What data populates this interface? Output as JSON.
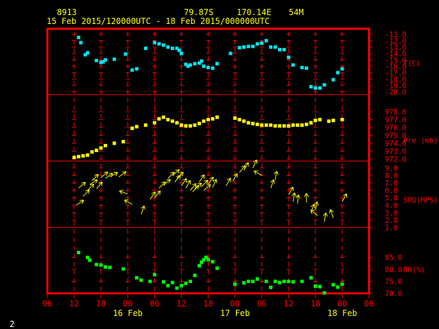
{
  "colors": {
    "background": "#000000",
    "frame": "#ff0000",
    "header_text": "#ffff00",
    "axis_labels": "#ff0000",
    "date_labels": "#ffff00",
    "temperature": "#00e5ee",
    "pressure": "#ffff00",
    "wind": "#ffff00",
    "humidity": "#00ff00",
    "page_number": "#ffffff"
  },
  "header": {
    "station_id": "8913",
    "latitude": "79.87S",
    "longitude": "170.14E",
    "elevation": "54M",
    "period": "15 Feb 2015/120000UTC - 18 Feb 2015/000000UTC"
  },
  "page_number": "2",
  "chart_data": {
    "type": "multi-panel time series",
    "x_axis": {
      "start": "2015-02-15 06:00 UTC",
      "end": "2015-02-18 06:00 UTC",
      "tick_labels": [
        "06",
        "12",
        "18",
        "00",
        "06",
        "12",
        "18",
        "00",
        "06",
        "12",
        "18",
        "00",
        "06"
      ],
      "date_labels": [
        {
          "label": "16 Feb",
          "at": "2015-02-16 00:00 UTC"
        },
        {
          "label": "17 Feb",
          "at": "2015-02-17 00:00 UTC"
        },
        {
          "label": "18 Feb",
          "at": "2015-02-18 00:00 UTC"
        }
      ]
    },
    "panels": [
      {
        "id": "temperature",
        "label": "T(C)",
        "type": "scatter",
        "ylim": [
          -20.0,
          -11.0
        ],
        "yticks": [
          "-11.0",
          "-12.0",
          "-13.0",
          "-14.0",
          "-15.0",
          "-16.0",
          "-17.0",
          "-18.0",
          "-19.0",
          "-20.0"
        ],
        "points": [
          [
            "2015-02-15 13:00",
            -11.5
          ],
          [
            "2015-02-15 13:30",
            -12.3
          ],
          [
            "2015-02-15 14:30",
            -14.2
          ],
          [
            "2015-02-15 15:00",
            -13.9
          ],
          [
            "2015-02-15 17:00",
            -15.1
          ],
          [
            "2015-02-15 18:00",
            -15.4
          ],
          [
            "2015-02-15 18:30",
            -15.3
          ],
          [
            "2015-02-15 19:00",
            -15.0
          ],
          [
            "2015-02-15 21:00",
            -14.9
          ],
          [
            "2015-02-15 23:30",
            -14.1
          ],
          [
            "2015-02-16 01:00",
            -16.6
          ],
          [
            "2015-02-16 02:00",
            -16.4
          ],
          [
            "2015-02-16 04:00",
            -13.2
          ],
          [
            "2015-02-16 06:00",
            -12.3
          ],
          [
            "2015-02-16 07:00",
            -12.5
          ],
          [
            "2015-02-16 08:00",
            -12.7
          ],
          [
            "2015-02-16 09:00",
            -13.0
          ],
          [
            "2015-02-16 10:00",
            -13.2
          ],
          [
            "2015-02-16 11:00",
            -13.2
          ],
          [
            "2015-02-16 11:30",
            -13.5
          ],
          [
            "2015-02-16 12:00",
            -14.0
          ],
          [
            "2015-02-16 13:00",
            -15.7
          ],
          [
            "2015-02-16 13:30",
            -16.0
          ],
          [
            "2015-02-16 14:00",
            -15.8
          ],
          [
            "2015-02-16 15:00",
            -15.6
          ],
          [
            "2015-02-16 16:00",
            -15.5
          ],
          [
            "2015-02-16 16:30",
            -15.2
          ],
          [
            "2015-02-16 17:00",
            -16.0
          ],
          [
            "2015-02-16 18:00",
            -16.2
          ],
          [
            "2015-02-16 19:00",
            -16.3
          ],
          [
            "2015-02-16 20:00",
            -15.6
          ],
          [
            "2015-02-16 23:00",
            -14.0
          ],
          [
            "2015-02-17 01:00",
            -13.1
          ],
          [
            "2015-02-17 02:00",
            -13.0
          ],
          [
            "2015-02-17 03:00",
            -12.9
          ],
          [
            "2015-02-17 04:00",
            -12.9
          ],
          [
            "2015-02-17 05:00",
            -12.5
          ],
          [
            "2015-02-17 06:00",
            -12.4
          ],
          [
            "2015-02-17 07:00",
            -12.0
          ],
          [
            "2015-02-17 08:00",
            -13.0
          ],
          [
            "2015-02-17 09:00",
            -13.0
          ],
          [
            "2015-02-17 10:00",
            -13.4
          ],
          [
            "2015-02-17 11:00",
            -13.4
          ],
          [
            "2015-02-17 12:00",
            -14.6
          ],
          [
            "2015-02-17 13:00",
            -15.8
          ],
          [
            "2015-02-17 15:00",
            -16.2
          ],
          [
            "2015-02-17 16:00",
            -16.3
          ],
          [
            "2015-02-17 17:00",
            -19.2
          ],
          [
            "2015-02-17 18:00",
            -19.4
          ],
          [
            "2015-02-17 19:00",
            -19.4
          ],
          [
            "2015-02-17 20:00",
            -18.9
          ],
          [
            "2015-02-17 22:00",
            -18.1
          ],
          [
            "2015-02-17 23:00",
            -17.0
          ],
          [
            "2015-02-18 00:00",
            -16.4
          ]
        ]
      },
      {
        "id": "pressure",
        "label": "Pre (mb)",
        "type": "scatter",
        "ylim": [
          972.0,
          978.0
        ],
        "yticks": [
          "978.0",
          "977.0",
          "976.0",
          "975.0",
          "974.0",
          "973.0",
          "972.0"
        ],
        "points": [
          [
            "2015-02-15 12:00",
            972.2
          ],
          [
            "2015-02-15 13:00",
            972.3
          ],
          [
            "2015-02-15 14:00",
            972.4
          ],
          [
            "2015-02-15 15:00",
            972.5
          ],
          [
            "2015-02-15 16:00",
            972.9
          ],
          [
            "2015-02-15 17:00",
            973.1
          ],
          [
            "2015-02-15 18:00",
            973.4
          ],
          [
            "2015-02-15 19:00",
            973.7
          ],
          [
            "2015-02-15 21:00",
            974.0
          ],
          [
            "2015-02-15 23:00",
            974.2
          ],
          [
            "2015-02-16 01:00",
            975.9
          ],
          [
            "2015-02-16 02:00",
            976.1
          ],
          [
            "2015-02-16 04:00",
            976.3
          ],
          [
            "2015-02-16 06:00",
            976.6
          ],
          [
            "2015-02-16 07:00",
            977.1
          ],
          [
            "2015-02-16 08:00",
            977.3
          ],
          [
            "2015-02-16 09:00",
            977.0
          ],
          [
            "2015-02-16 10:00",
            976.8
          ],
          [
            "2015-02-16 11:00",
            976.6
          ],
          [
            "2015-02-16 12:00",
            976.3
          ],
          [
            "2015-02-16 13:00",
            976.2
          ],
          [
            "2015-02-16 14:00",
            976.2
          ],
          [
            "2015-02-16 15:00",
            976.3
          ],
          [
            "2015-02-16 16:00",
            976.5
          ],
          [
            "2015-02-16 17:00",
            976.8
          ],
          [
            "2015-02-16 18:00",
            977.0
          ],
          [
            "2015-02-16 19:00",
            977.1
          ],
          [
            "2015-02-16 20:00",
            977.3
          ],
          [
            "2015-02-17 00:00",
            977.2
          ],
          [
            "2015-02-17 01:00",
            977.0
          ],
          [
            "2015-02-17 02:00",
            976.8
          ],
          [
            "2015-02-17 03:00",
            976.6
          ],
          [
            "2015-02-17 04:00",
            976.5
          ],
          [
            "2015-02-17 05:00",
            976.4
          ],
          [
            "2015-02-17 06:00",
            976.3
          ],
          [
            "2015-02-17 07:00",
            976.3
          ],
          [
            "2015-02-17 08:00",
            976.3
          ],
          [
            "2015-02-17 09:00",
            976.2
          ],
          [
            "2015-02-17 10:00",
            976.2
          ],
          [
            "2015-02-17 11:00",
            976.2
          ],
          [
            "2015-02-17 12:00",
            976.2
          ],
          [
            "2015-02-17 13:00",
            976.3
          ],
          [
            "2015-02-17 14:00",
            976.3
          ],
          [
            "2015-02-17 15:00",
            976.3
          ],
          [
            "2015-02-17 16:00",
            976.4
          ],
          [
            "2015-02-17 17:00",
            976.6
          ],
          [
            "2015-02-17 18:00",
            976.9
          ],
          [
            "2015-02-17 19:00",
            977.0
          ],
          [
            "2015-02-17 21:00",
            976.8
          ],
          [
            "2015-02-17 22:00",
            976.9
          ],
          [
            "2015-02-18 00:00",
            977.0
          ]
        ]
      },
      {
        "id": "wind",
        "label": "SPD(MPS)",
        "type": "vector",
        "ylim": [
          1.0,
          9.0
        ],
        "yticks": [
          "9.0",
          "8.0",
          "7.0",
          "6.0",
          "5.0",
          "4.0",
          "3.0",
          "2.0",
          "1.0"
        ],
        "points": [
          [
            "2015-02-15 12:30",
            4.0,
            35
          ],
          [
            "2015-02-15 13:00",
            6.3,
            40
          ],
          [
            "2015-02-15 14:00",
            5.2,
            45
          ],
          [
            "2015-02-15 15:00",
            6.0,
            45
          ],
          [
            "2015-02-15 15:30",
            6.8,
            30
          ],
          [
            "2015-02-15 16:00",
            7.3,
            45
          ],
          [
            "2015-02-15 17:00",
            6.2,
            50
          ],
          [
            "2015-02-15 18:00",
            7.7,
            40
          ],
          [
            "2015-02-15 19:00",
            7.6,
            35
          ],
          [
            "2015-02-15 20:00",
            7.8,
            30
          ],
          [
            "2015-02-15 22:00",
            7.8,
            35
          ],
          [
            "2015-02-16 00:00",
            5.5,
            160
          ],
          [
            "2015-02-16 01:00",
            4.1,
            150
          ],
          [
            "2015-02-16 03:00",
            2.8,
            70
          ],
          [
            "2015-02-16 05:00",
            4.8,
            55
          ],
          [
            "2015-02-16 06:00",
            5.0,
            50
          ],
          [
            "2015-02-16 07:00",
            6.3,
            45
          ],
          [
            "2015-02-16 08:00",
            6.7,
            40
          ],
          [
            "2015-02-16 09:00",
            7.6,
            45
          ],
          [
            "2015-02-16 10:00",
            8.0,
            40
          ],
          [
            "2015-02-16 10:30",
            7.1,
            50
          ],
          [
            "2015-02-16 11:00",
            7.6,
            45
          ],
          [
            "2015-02-16 12:00",
            6.6,
            55
          ],
          [
            "2015-02-16 13:00",
            6.3,
            60
          ],
          [
            "2015-02-16 14:00",
            6.0,
            50
          ],
          [
            "2015-02-16 14:30",
            5.8,
            45
          ],
          [
            "2015-02-16 15:00",
            6.2,
            40
          ],
          [
            "2015-02-16 16:00",
            7.1,
            55
          ],
          [
            "2015-02-16 16:30",
            6.5,
            45
          ],
          [
            "2015-02-16 17:00",
            6.0,
            40
          ],
          [
            "2015-02-16 18:00",
            6.8,
            55
          ],
          [
            "2015-02-16 19:00",
            6.4,
            65
          ],
          [
            "2015-02-16 22:00",
            6.6,
            60
          ],
          [
            "2015-02-16 23:30",
            7.2,
            60
          ],
          [
            "2015-02-17 01:00",
            8.4,
            50
          ],
          [
            "2015-02-17 02:00",
            8.7,
            60
          ],
          [
            "2015-02-17 04:00",
            9.0,
            65
          ],
          [
            "2015-02-17 06:00",
            8.0,
            150
          ],
          [
            "2015-02-17 08:00",
            6.3,
            70
          ],
          [
            "2015-02-17 09:00",
            7.4,
            80
          ],
          [
            "2015-02-17 12:00",
            5.4,
            60
          ],
          [
            "2015-02-17 13:00",
            4.5,
            80
          ],
          [
            "2015-02-17 14:00",
            4.2,
            85
          ],
          [
            "2015-02-17 16:00",
            4.4,
            90
          ],
          [
            "2015-02-17 17:00",
            3.0,
            70
          ],
          [
            "2015-02-17 18:00",
            3.3,
            80
          ],
          [
            "2015-02-17 18:30",
            2.6,
            140
          ],
          [
            "2015-02-17 20:00",
            1.8,
            80
          ],
          [
            "2015-02-17 22:00",
            2.3,
            110
          ],
          [
            "2015-02-18 00:00",
            4.5,
            60
          ]
        ]
      },
      {
        "id": "humidity",
        "label": "RH(%)",
        "type": "scatter",
        "ylim": [
          70.0,
          90.0
        ],
        "yticks": [
          "85.0",
          "80.0",
          "75.0",
          "70.0"
        ],
        "points": [
          [
            "2015-02-15 13:00",
            87.0
          ],
          [
            "2015-02-15 15:00",
            85.0
          ],
          [
            "2015-02-15 15:30",
            83.8
          ],
          [
            "2015-02-15 17:00",
            82.0
          ],
          [
            "2015-02-15 18:00",
            81.8
          ],
          [
            "2015-02-15 19:00",
            81.0
          ],
          [
            "2015-02-15 20:00",
            80.8
          ],
          [
            "2015-02-15 23:00",
            80.2
          ],
          [
            "2015-02-16 02:00",
            76.5
          ],
          [
            "2015-02-16 03:00",
            75.5
          ],
          [
            "2015-02-16 05:00",
            75.0
          ],
          [
            "2015-02-16 06:00",
            77.8
          ],
          [
            "2015-02-16 08:00",
            74.8
          ],
          [
            "2015-02-16 09:00",
            73.2
          ],
          [
            "2015-02-16 10:00",
            74.5
          ],
          [
            "2015-02-16 11:00",
            72.2
          ],
          [
            "2015-02-16 12:00",
            73.2
          ],
          [
            "2015-02-16 13:00",
            74.2
          ],
          [
            "2015-02-16 14:00",
            75.0
          ],
          [
            "2015-02-16 15:00",
            77.5
          ],
          [
            "2015-02-16 16:00",
            81.5
          ],
          [
            "2015-02-16 16:30",
            83.0
          ],
          [
            "2015-02-16 17:00",
            84.0
          ],
          [
            "2015-02-16 17:30",
            85.0
          ],
          [
            "2015-02-16 18:00",
            84.0
          ],
          [
            "2015-02-16 19:00",
            83.2
          ],
          [
            "2015-02-16 20:00",
            80.5
          ],
          [
            "2015-02-17 00:00",
            73.8
          ],
          [
            "2015-02-17 02:00",
            74.4
          ],
          [
            "2015-02-17 03:00",
            75.0
          ],
          [
            "2015-02-17 04:00",
            75.0
          ],
          [
            "2015-02-17 05:00",
            76.0
          ],
          [
            "2015-02-17 07:00",
            75.0
          ],
          [
            "2015-02-17 08:00",
            72.5
          ],
          [
            "2015-02-17 09:00",
            75.0
          ],
          [
            "2015-02-17 10:00",
            74.5
          ],
          [
            "2015-02-17 11:00",
            75.0
          ],
          [
            "2015-02-17 12:00",
            75.0
          ],
          [
            "2015-02-17 13:00",
            74.8
          ],
          [
            "2015-02-17 15:00",
            75.0
          ],
          [
            "2015-02-17 17:00",
            76.5
          ],
          [
            "2015-02-17 18:00",
            73.0
          ],
          [
            "2015-02-17 19:00",
            72.8
          ],
          [
            "2015-02-17 20:00",
            70.2
          ],
          [
            "2015-02-17 22:00",
            73.6
          ],
          [
            "2015-02-17 23:00",
            72.6
          ],
          [
            "2015-02-18 00:00",
            73.8
          ]
        ]
      }
    ]
  }
}
